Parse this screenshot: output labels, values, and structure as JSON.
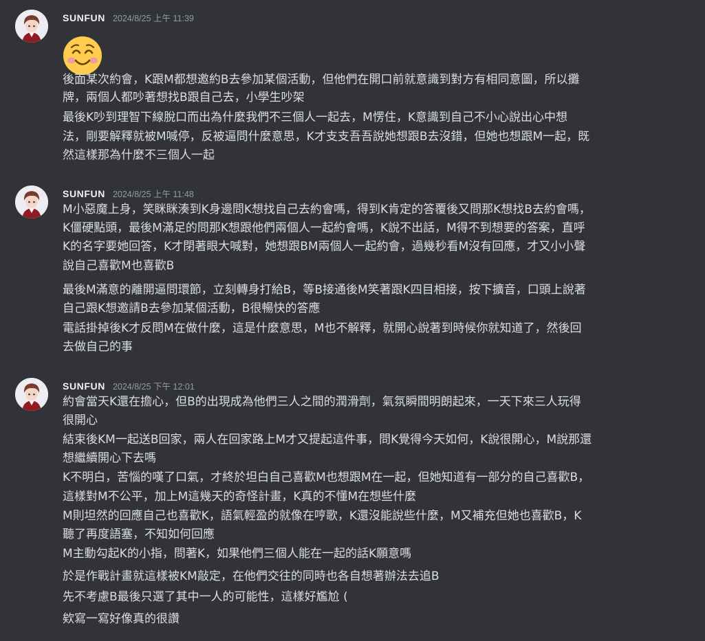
{
  "messages": [
    {
      "username": "SUNFUN",
      "timestamp": "2024/8/25 上午 11:39",
      "emoji": "smiling-face-with-smiling-eyes",
      "lines": [
        "後面某次約會，K跟M都想邀約B去參加某個活動，但他們在開口前就意識到對方有相同意圖，所以攤",
        "牌，兩個人都吵著想找B跟自己去，小學生吵架",
        "最後K吵到理智下線脫口而出為什麼我們不三個人一起去，M愣住，K意識到自己不小心說出心中想",
        "法，剛要解釋就被M喊停，反被逼問什麼意思，K才支支吾吾說她想跟B去沒錯，但她也想跟M一起，既",
        "然這樣那為什麼不三個人一起"
      ]
    },
    {
      "username": "SUNFUN",
      "timestamp": "2024/8/25 上午 11:48",
      "lines": [
        "M小惡魔上身，笑眯眯湊到K身邊問K想找自己去約會嗎，得到K肯定的答覆後又問那K想找B去約會嗎，",
        "K僵硬點頭，最後M滿足的問那K想跟他們兩個人一起約會嗎，K說不出話，M得不到想要的答案，直呼",
        "K的名字要她回答，K才閉著眼大喊對，她想跟BM兩個人一起約會，過幾秒看M沒有回應，才又小小聲",
        "說自己喜歡M也喜歡B",
        "最後M滿意的離開逼問環節，立刻轉身打給B，等B接通後M笑著跟K四目相接，按下擴音，口頭上說著",
        "自己跟K想邀請B去參加某個活動，B很暢快的答應",
        "電話掛掉後K才反問M在做什麼，這是什麼意思，M也不解釋，就開心說著到時候你就知道了，然後回",
        "去做自己的事"
      ]
    },
    {
      "username": "SUNFUN",
      "timestamp": "2024/8/25 下午 12:01",
      "lines": [
        "約會當天K還在擔心，但B的出現成為他們三人之間的潤滑劑，氣氛瞬間明朗起來，一天下來三人玩得",
        "很開心",
        "結束後KM一起送B回家，兩人在回家路上M才又提起這件事，問K覺得今天如何，K說很開心，M說那還",
        "想繼續開心下去嗎",
        "K不明白，苦惱的嘆了口氣，才終於坦白自己喜歡M也想跟M在一起，但她知道有一部分的自己喜歡B，",
        "這樣對M不公平，加上M這幾天的奇怪計畫，K真的不懂M在想些什麼",
        "M則坦然的回應自己也喜歡K，語氣輕盈的就像在哼歌，K還沒能說些什麼，M又補充但她也喜歡B，K",
        "聽了再度語塞，不知如何回應",
        "M主動勾起K的小指，問著K，如果他們三個人能在一起的話K願意嗎",
        "於是作戰計畫就這樣被KM敲定，在他們交往的同時也各自想著辦法去追B",
        "先不考慮B最後只選了其中一人的可能性，這樣好尷尬 (",
        "欸寫一寫好像真的很讚"
      ]
    }
  ]
}
